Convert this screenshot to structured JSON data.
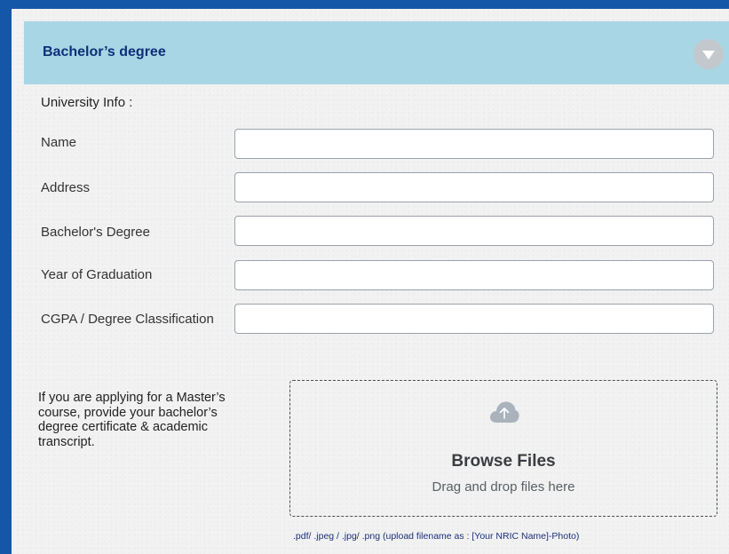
{
  "header": {
    "title": "Bachelor’s degree",
    "toggle_icon": "chevron-down-circle-icon"
  },
  "section_label": "University Info :",
  "fields": [
    {
      "label": "Name",
      "value": ""
    },
    {
      "label": "Address",
      "value": ""
    },
    {
      "label": "Bachelor's Degree",
      "value": ""
    },
    {
      "label": "Year of Graduation",
      "value": ""
    },
    {
      "label": "CGPA / Degree Classification",
      "value": ""
    }
  ],
  "upload": {
    "note": "If you are applying for a Master’s course, provide your bachelor’s degree certificate & academic transcript.",
    "icon": "cloud-upload-icon",
    "title": "Browse Files",
    "subtitle": "Drag and drop files here",
    "hint": ".pdf/ .jpeg / .jpg/ .png (upload filename as : [Your NRIC Name]-Photo)"
  },
  "colors": {
    "page_border": "#1457a8",
    "header_bg": "#a9d6e5",
    "header_text": "#0e2f78",
    "hint_text": "#1d2f7a"
  }
}
